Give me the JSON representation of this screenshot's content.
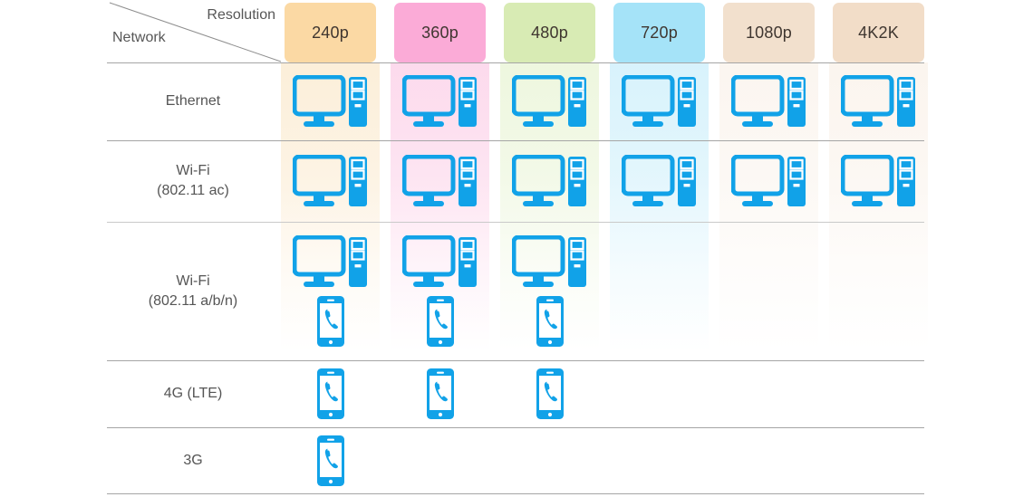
{
  "table": {
    "corner": {
      "column_axis_label": "Resolution",
      "row_axis_label": "Network"
    },
    "columns": [
      {
        "key": "240p",
        "label": "240p",
        "color": "#fbd9a4",
        "tint": "#f8d8a5"
      },
      {
        "key": "360p",
        "label": "360p",
        "color": "#fbabd7",
        "tint": "#f9a7d3"
      },
      {
        "key": "480p",
        "label": "480p",
        "color": "#d8ebb4",
        "tint": "#d6ebb2"
      },
      {
        "key": "720p",
        "label": "720p",
        "color": "#a5e3f8",
        "tint": "#a2e1f7"
      },
      {
        "key": "1080p",
        "label": "1080p",
        "color": "#f2e0cd",
        "tint": "#f2e0cd"
      },
      {
        "key": "4K2K",
        "label": "4K2K",
        "color": "#f2ddc8",
        "tint": "#f2ddc8"
      }
    ],
    "rows": [
      {
        "key": "ethernet",
        "label_lines": [
          "Ethernet"
        ]
      },
      {
        "key": "wifi-ac",
        "label_lines": [
          "Wi-Fi",
          "(802.11 ac)"
        ]
      },
      {
        "key": "wifi-abgn",
        "label_lines": [
          "Wi-Fi",
          "(802.11 a/b/n)"
        ]
      },
      {
        "key": "4g-lte",
        "label_lines": [
          "4G (LTE)"
        ]
      },
      {
        "key": "3g",
        "label_lines": [
          "3G"
        ]
      }
    ],
    "support_matrix": [
      {
        "row": "ethernet",
        "cells": [
          "desktop",
          "desktop",
          "desktop",
          "desktop",
          "desktop",
          "desktop"
        ]
      },
      {
        "row": "wifi-ac",
        "cells": [
          "desktop",
          "desktop",
          "desktop",
          "desktop",
          "desktop",
          "desktop"
        ]
      },
      {
        "row": "wifi-abgn",
        "cells": [
          "desktop+phone",
          "desktop+phone",
          "desktop+phone",
          "",
          "",
          ""
        ]
      },
      {
        "row": "4g-lte",
        "cells": [
          "phone",
          "phone",
          "phone",
          "",
          "",
          ""
        ]
      },
      {
        "row": "3g",
        "cells": [
          "phone",
          "",
          "",
          "",
          "",
          ""
        ]
      }
    ],
    "icons": {
      "desktop": "desktop-computer-icon",
      "phone": "smartphone-call-icon"
    },
    "colors": {
      "icon_blue": "#11a2e8",
      "grid_line": "#a5a5a5",
      "text": "#555555"
    }
  }
}
